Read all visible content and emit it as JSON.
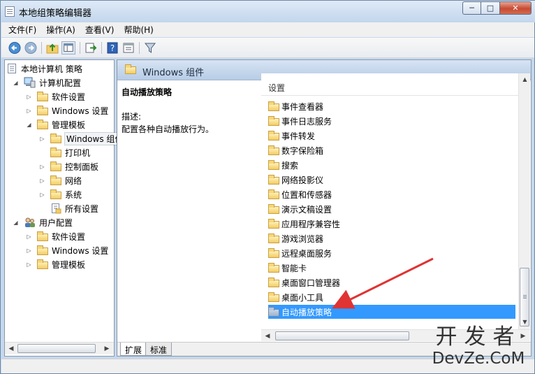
{
  "window": {
    "title": "本地组策略编辑器",
    "caption": {
      "minimize": "─",
      "maximize": "□",
      "close": "✕"
    }
  },
  "menu": [
    "文件(F)",
    "操作(A)",
    "查看(V)",
    "帮助(H)"
  ],
  "toolbar_icons": [
    "back-arrow-icon",
    "forward-arrow-icon",
    "up-folder-icon",
    "show-hide-tree-icon",
    "export-list-icon",
    "help-icon",
    "properties-icon",
    "filter-icon"
  ],
  "tree": [
    {
      "label": "本地计算机 策略",
      "icon": "policy-doc-icon",
      "expander": ""
    },
    {
      "label": "计算机配置",
      "icon": "computer-icon",
      "expander": "◢"
    },
    {
      "label": "软件设置",
      "icon": "folder-icon",
      "expander": "▷"
    },
    {
      "label": "Windows 设置",
      "icon": "folder-icon",
      "expander": "▷"
    },
    {
      "label": "管理模板",
      "icon": "folder-icon",
      "expander": "◢"
    },
    {
      "label": "Windows 组件",
      "icon": "folder-icon",
      "expander": "▷"
    },
    {
      "label": "打印机",
      "icon": "folder-icon",
      "expander": ""
    },
    {
      "label": "控制面板",
      "icon": "folder-icon",
      "expander": "▷"
    },
    {
      "label": "网络",
      "icon": "folder-icon",
      "expander": "▷"
    },
    {
      "label": "系统",
      "icon": "folder-icon",
      "expander": "▷"
    },
    {
      "label": "所有设置",
      "icon": "settings-doc-icon",
      "expander": ""
    },
    {
      "label": "用户配置",
      "icon": "users-icon",
      "expander": "◢"
    },
    {
      "label": "软件设置",
      "icon": "folder-icon",
      "expander": "▷"
    },
    {
      "label": "Windows 设置",
      "icon": "folder-icon",
      "expander": "▷"
    },
    {
      "label": "管理模板",
      "icon": "folder-icon",
      "expander": "▷"
    }
  ],
  "header": {
    "title": "Windows 组件"
  },
  "description": {
    "title": "自动播放策略",
    "label": "描述:",
    "text": "配置各种自动播放行为。"
  },
  "list": {
    "column": "设置",
    "items": [
      "事件查看器",
      "事件日志服务",
      "事件转发",
      "数字保险箱",
      "搜索",
      "网络投影仪",
      "位置和传感器",
      "演示文稿设置",
      "应用程序兼容性",
      "游戏浏览器",
      "远程桌面服务",
      "智能卡",
      "桌面窗口管理器",
      "桌面小工具",
      "自动播放策略"
    ],
    "selected_index": 14
  },
  "tabs": [
    "扩展",
    "标准"
  ],
  "watermark": {
    "top": "开发者",
    "bottom": "DevZe.CoM"
  },
  "colors": {
    "selection": "#3399ff",
    "arrow": "#e03333",
    "folder": "#f3cd61"
  }
}
